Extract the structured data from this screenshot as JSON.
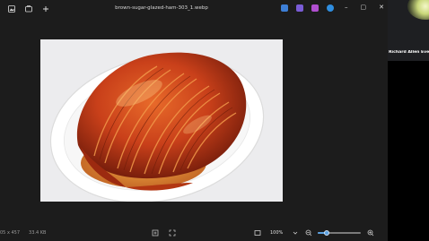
{
  "window": {
    "title": "brown-sugar-glazed-ham-303_1.webp",
    "toolbar_icons": [
      "image-icon",
      "gallery-icon",
      "add-icon"
    ],
    "app_icons": [
      "pen-edit-icon",
      "paint-icon",
      "clipchamp-icon",
      "onedrive-icon"
    ],
    "controls": {
      "minimize": "–",
      "maximize": "▢",
      "close": "✕"
    }
  },
  "image": {
    "subject": "brown sugar glazed spiral ham on white oval platter"
  },
  "statusbar": {
    "dimensions": "05 x 457",
    "file_size": "33.4 KB",
    "zoom": "100%",
    "zoom_fraction": 0.2
  },
  "call": {
    "participant_name": "Richard Allen Eve"
  },
  "colors": {
    "accent": "#5aa0e0",
    "viewer_bg": "#1c1c1c"
  }
}
